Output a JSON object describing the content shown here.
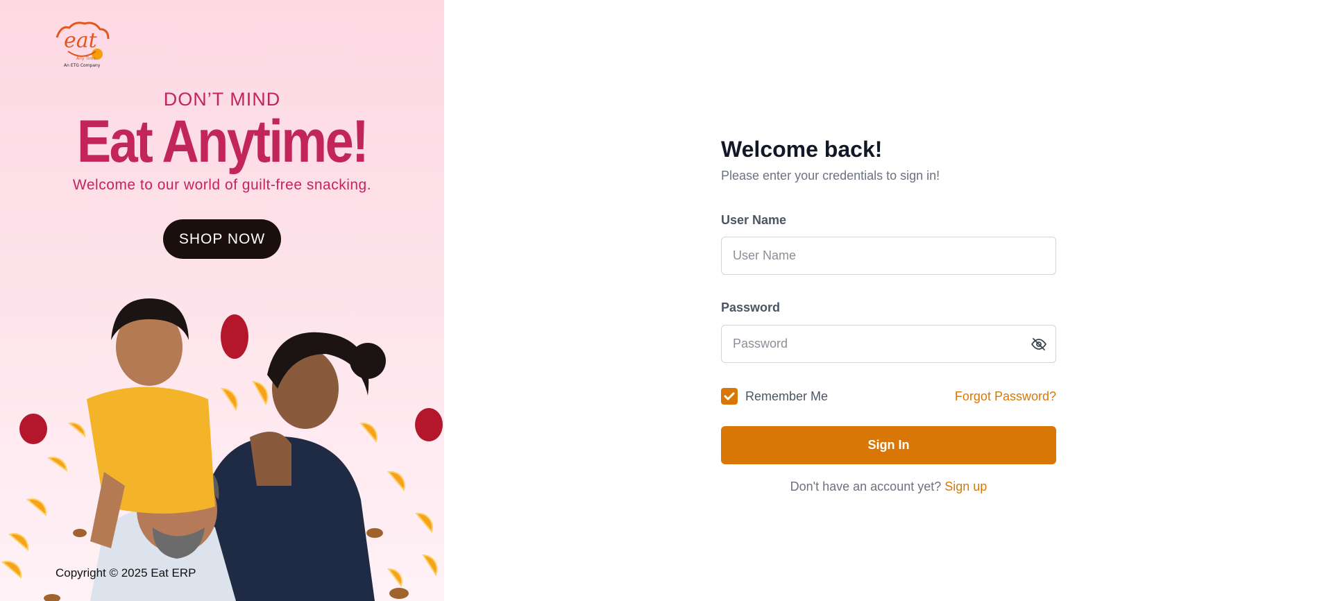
{
  "brand": {
    "logo_word": "eat",
    "logo_tagline": "Any Time",
    "logo_company": "An ETG Company"
  },
  "banner": {
    "kicker": "DON’T MIND",
    "title": "Eat Anytime!",
    "subtitle": "Welcome to our world of guilt-free snacking.",
    "cta": "SHOP NOW"
  },
  "footer": {
    "copyright": "Copyright © 2025 Eat ERP"
  },
  "login": {
    "title": "Welcome back!",
    "subtitle": "Please enter your credentials to sign in!",
    "username_label": "User Name",
    "username_placeholder": "User Name",
    "username_value": "",
    "password_label": "Password",
    "password_placeholder": "Password",
    "password_value": "",
    "remember_label": "Remember Me",
    "remember_checked": true,
    "forgot_label": "Forgot Password?",
    "signin_label": "Sign In",
    "signup_prompt": "Don't have an account yet?",
    "signup_link": "Sign up"
  },
  "colors": {
    "accent": "#d97706",
    "banner_text": "#c2255c",
    "banner_bg": "#fdd9e4",
    "heading": "#111827"
  },
  "icons": {
    "password_toggle": "eye-off-icon",
    "checkbox": "check-icon"
  }
}
